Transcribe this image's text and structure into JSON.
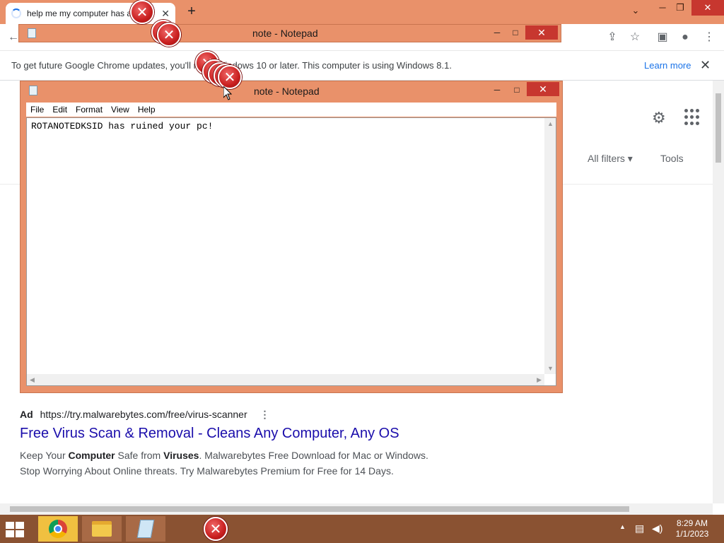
{
  "chrome": {
    "tab_title": "help me my computer has a virus",
    "new_tab_glyph": "+",
    "tab_close_glyph": "✕",
    "minimize": "─",
    "restore": "❐",
    "close": "✕",
    "toolbar_icons": [
      "back-icon",
      "share-icon",
      "star-icon",
      "sidepanel-icon",
      "profile-icon",
      "menu-icon"
    ]
  },
  "infobar": {
    "message": "To get future Google Chrome updates, you'll need Windows 10 or later. This computer is using Windows 8.1.",
    "learn_more": "Learn more",
    "close": "✕"
  },
  "google": {
    "all_filters": "All filters ▾",
    "tools": "Tools",
    "ad": {
      "label": "Ad",
      "url": "https://try.malwarebytes.com/free/virus-scanner",
      "more": "⋮",
      "title": "Free Virus Scan & Removal - Cleans Any Computer, Any OS",
      "desc_1a": "Keep Your ",
      "desc_1b": "Computer",
      "desc_1c": " Safe from ",
      "desc_1d": "Viruses",
      "desc_1e": ". Malwarebytes Free Download for Mac or Windows.",
      "desc_2": "Stop Worrying About Online threats. Try Malwarebytes Premium for Free for 14 Days."
    }
  },
  "notepad_back": {
    "title": "note - Notepad"
  },
  "notepad": {
    "title": "note - Notepad",
    "menu": [
      "File",
      "Edit",
      "Format",
      "View",
      "Help"
    ],
    "content": "ROTANOTEDKSID has ruined your pc!",
    "minimize": "─",
    "maximize": "□",
    "close": "✕"
  },
  "error_glyph": "✕",
  "taskbar": {
    "time": "8:29 AM",
    "date": "1/1/2023",
    "tray_up": "▲"
  },
  "colors": {
    "accent": "#e9916a",
    "taskbar": "#8a5232",
    "close_red": "#c7372f",
    "link_blue": "#1a0dab"
  }
}
